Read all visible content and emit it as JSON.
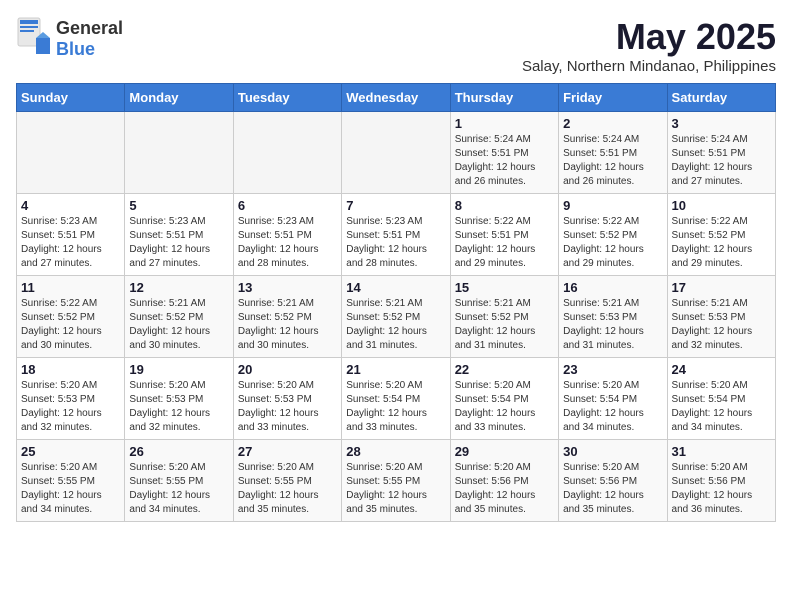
{
  "header": {
    "logo_general": "General",
    "logo_blue": "Blue",
    "title": "May 2025",
    "subtitle": "Salay, Northern Mindanao, Philippines"
  },
  "weekdays": [
    "Sunday",
    "Monday",
    "Tuesday",
    "Wednesday",
    "Thursday",
    "Friday",
    "Saturday"
  ],
  "weeks": [
    [
      {
        "day": "",
        "sunrise": "",
        "sunset": "",
        "daylight": ""
      },
      {
        "day": "",
        "sunrise": "",
        "sunset": "",
        "daylight": ""
      },
      {
        "day": "",
        "sunrise": "",
        "sunset": "",
        "daylight": ""
      },
      {
        "day": "",
        "sunrise": "",
        "sunset": "",
        "daylight": ""
      },
      {
        "day": "1",
        "sunrise": "Sunrise: 5:24 AM",
        "sunset": "Sunset: 5:51 PM",
        "daylight": "Daylight: 12 hours and 26 minutes."
      },
      {
        "day": "2",
        "sunrise": "Sunrise: 5:24 AM",
        "sunset": "Sunset: 5:51 PM",
        "daylight": "Daylight: 12 hours and 26 minutes."
      },
      {
        "day": "3",
        "sunrise": "Sunrise: 5:24 AM",
        "sunset": "Sunset: 5:51 PM",
        "daylight": "Daylight: 12 hours and 27 minutes."
      }
    ],
    [
      {
        "day": "4",
        "sunrise": "Sunrise: 5:23 AM",
        "sunset": "Sunset: 5:51 PM",
        "daylight": "Daylight: 12 hours and 27 minutes."
      },
      {
        "day": "5",
        "sunrise": "Sunrise: 5:23 AM",
        "sunset": "Sunset: 5:51 PM",
        "daylight": "Daylight: 12 hours and 27 minutes."
      },
      {
        "day": "6",
        "sunrise": "Sunrise: 5:23 AM",
        "sunset": "Sunset: 5:51 PM",
        "daylight": "Daylight: 12 hours and 28 minutes."
      },
      {
        "day": "7",
        "sunrise": "Sunrise: 5:23 AM",
        "sunset": "Sunset: 5:51 PM",
        "daylight": "Daylight: 12 hours and 28 minutes."
      },
      {
        "day": "8",
        "sunrise": "Sunrise: 5:22 AM",
        "sunset": "Sunset: 5:51 PM",
        "daylight": "Daylight: 12 hours and 29 minutes."
      },
      {
        "day": "9",
        "sunrise": "Sunrise: 5:22 AM",
        "sunset": "Sunset: 5:52 PM",
        "daylight": "Daylight: 12 hours and 29 minutes."
      },
      {
        "day": "10",
        "sunrise": "Sunrise: 5:22 AM",
        "sunset": "Sunset: 5:52 PM",
        "daylight": "Daylight: 12 hours and 29 minutes."
      }
    ],
    [
      {
        "day": "11",
        "sunrise": "Sunrise: 5:22 AM",
        "sunset": "Sunset: 5:52 PM",
        "daylight": "Daylight: 12 hours and 30 minutes."
      },
      {
        "day": "12",
        "sunrise": "Sunrise: 5:21 AM",
        "sunset": "Sunset: 5:52 PM",
        "daylight": "Daylight: 12 hours and 30 minutes."
      },
      {
        "day": "13",
        "sunrise": "Sunrise: 5:21 AM",
        "sunset": "Sunset: 5:52 PM",
        "daylight": "Daylight: 12 hours and 30 minutes."
      },
      {
        "day": "14",
        "sunrise": "Sunrise: 5:21 AM",
        "sunset": "Sunset: 5:52 PM",
        "daylight": "Daylight: 12 hours and 31 minutes."
      },
      {
        "day": "15",
        "sunrise": "Sunrise: 5:21 AM",
        "sunset": "Sunset: 5:52 PM",
        "daylight": "Daylight: 12 hours and 31 minutes."
      },
      {
        "day": "16",
        "sunrise": "Sunrise: 5:21 AM",
        "sunset": "Sunset: 5:53 PM",
        "daylight": "Daylight: 12 hours and 31 minutes."
      },
      {
        "day": "17",
        "sunrise": "Sunrise: 5:21 AM",
        "sunset": "Sunset: 5:53 PM",
        "daylight": "Daylight: 12 hours and 32 minutes."
      }
    ],
    [
      {
        "day": "18",
        "sunrise": "Sunrise: 5:20 AM",
        "sunset": "Sunset: 5:53 PM",
        "daylight": "Daylight: 12 hours and 32 minutes."
      },
      {
        "day": "19",
        "sunrise": "Sunrise: 5:20 AM",
        "sunset": "Sunset: 5:53 PM",
        "daylight": "Daylight: 12 hours and 32 minutes."
      },
      {
        "day": "20",
        "sunrise": "Sunrise: 5:20 AM",
        "sunset": "Sunset: 5:53 PM",
        "daylight": "Daylight: 12 hours and 33 minutes."
      },
      {
        "day": "21",
        "sunrise": "Sunrise: 5:20 AM",
        "sunset": "Sunset: 5:54 PM",
        "daylight": "Daylight: 12 hours and 33 minutes."
      },
      {
        "day": "22",
        "sunrise": "Sunrise: 5:20 AM",
        "sunset": "Sunset: 5:54 PM",
        "daylight": "Daylight: 12 hours and 33 minutes."
      },
      {
        "day": "23",
        "sunrise": "Sunrise: 5:20 AM",
        "sunset": "Sunset: 5:54 PM",
        "daylight": "Daylight: 12 hours and 34 minutes."
      },
      {
        "day": "24",
        "sunrise": "Sunrise: 5:20 AM",
        "sunset": "Sunset: 5:54 PM",
        "daylight": "Daylight: 12 hours and 34 minutes."
      }
    ],
    [
      {
        "day": "25",
        "sunrise": "Sunrise: 5:20 AM",
        "sunset": "Sunset: 5:55 PM",
        "daylight": "Daylight: 12 hours and 34 minutes."
      },
      {
        "day": "26",
        "sunrise": "Sunrise: 5:20 AM",
        "sunset": "Sunset: 5:55 PM",
        "daylight": "Daylight: 12 hours and 34 minutes."
      },
      {
        "day": "27",
        "sunrise": "Sunrise: 5:20 AM",
        "sunset": "Sunset: 5:55 PM",
        "daylight": "Daylight: 12 hours and 35 minutes."
      },
      {
        "day": "28",
        "sunrise": "Sunrise: 5:20 AM",
        "sunset": "Sunset: 5:55 PM",
        "daylight": "Daylight: 12 hours and 35 minutes."
      },
      {
        "day": "29",
        "sunrise": "Sunrise: 5:20 AM",
        "sunset": "Sunset: 5:56 PM",
        "daylight": "Daylight: 12 hours and 35 minutes."
      },
      {
        "day": "30",
        "sunrise": "Sunrise: 5:20 AM",
        "sunset": "Sunset: 5:56 PM",
        "daylight": "Daylight: 12 hours and 35 minutes."
      },
      {
        "day": "31",
        "sunrise": "Sunrise: 5:20 AM",
        "sunset": "Sunset: 5:56 PM",
        "daylight": "Daylight: 12 hours and 36 minutes."
      }
    ]
  ]
}
